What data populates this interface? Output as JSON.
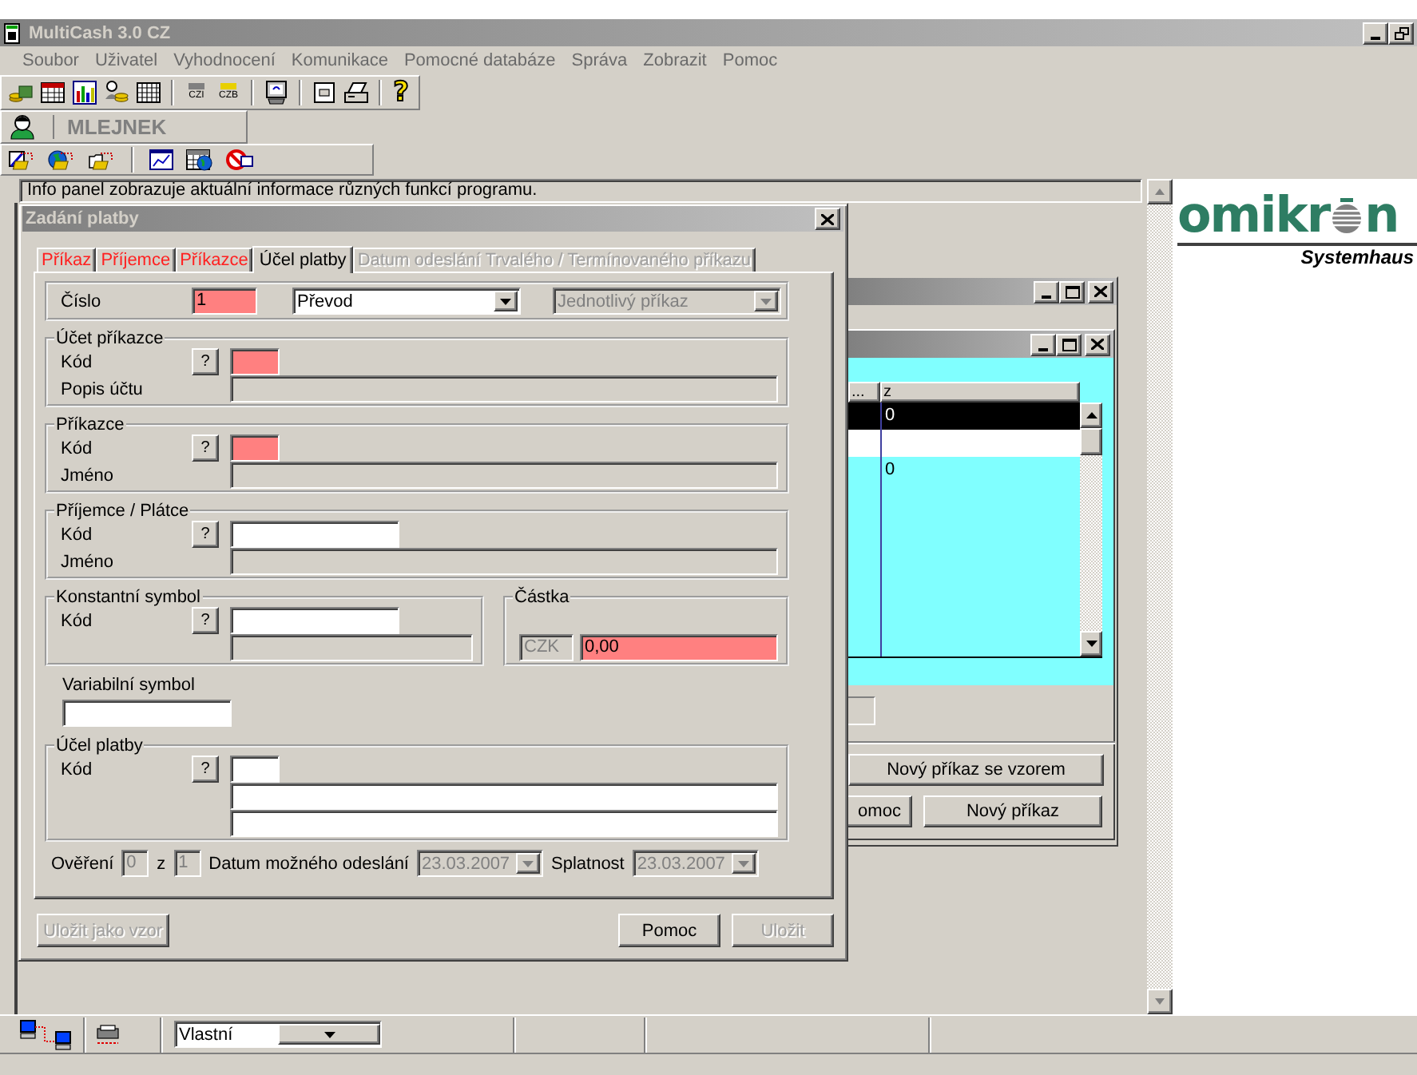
{
  "window": {
    "title": "MultiCash 3.0 CZ"
  },
  "menu": [
    "Soubor",
    "Uživatel",
    "Vyhodnocení",
    "Komunikace",
    "Pomocné databáze",
    "Správa",
    "Zobrazit",
    "Pomoc"
  ],
  "toolbar": {
    "card_labels": [
      "CZI",
      "CZB"
    ],
    "help": "?"
  },
  "user": {
    "name": "MLEJNEK"
  },
  "info_panel": "Info panel zobrazuje aktuální informace různých funkcí programu.",
  "logo": {
    "text_before": "omikr",
    "text_after": "n",
    "tagline": "Systemhaus"
  },
  "order_window": {
    "table": {
      "columns": [
        "...",
        "z"
      ],
      "rows": [
        {
          "value": "0",
          "selected": true,
          "highlighted": false
        },
        {
          "selected": false,
          "highlighted": true
        },
        {
          "value": "0",
          "selected": false,
          "highlighted": false
        }
      ]
    },
    "buttons": [
      "Nový příkaz se vzorem",
      "omoc",
      "Nový příkaz"
    ]
  },
  "dialog": {
    "title": "Zadání platby",
    "tabs": [
      {
        "label": "Příkaz",
        "selected": false,
        "invalid": true,
        "disabled": false
      },
      {
        "label": "Příjemce",
        "selected": false,
        "invalid": true,
        "disabled": false
      },
      {
        "label": "Příkazce",
        "selected": false,
        "invalid": true,
        "disabled": false
      },
      {
        "label": "Účel platby",
        "selected": true,
        "invalid": false,
        "disabled": false
      },
      {
        "label": "Datum odeslání Trvalého / Termínovaného příkazu",
        "selected": false,
        "invalid": false,
        "disabled": true
      }
    ],
    "number": {
      "label": "Číslo",
      "value": "1",
      "required": true
    },
    "payment_type": {
      "value": "Převod",
      "disabled": false
    },
    "order_type": {
      "value": "Jednotlivý příkaz",
      "disabled": true
    },
    "groups": [
      {
        "title": "Účet příkazce",
        "rows": [
          {
            "label": "Kód",
            "help": "?",
            "field": {
              "kind": "code",
              "required": true,
              "disabled": false
            }
          },
          {
            "label": "Popis účtu",
            "field": {
              "kind": "description",
              "required": false,
              "disabled": true
            }
          }
        ]
      },
      {
        "title": "Příkazce",
        "rows": [
          {
            "label": "Kód",
            "help": "?",
            "field": {
              "kind": "code",
              "required": true,
              "disabled": false
            }
          },
          {
            "label": "Jméno",
            "field": {
              "kind": "description",
              "required": false,
              "disabled": true
            }
          }
        ]
      },
      {
        "title": "Příjemce / Plátce",
        "rows": [
          {
            "label": "Kód",
            "help": "?",
            "field": {
              "kind": "text",
              "required": false,
              "disabled": false
            }
          },
          {
            "label": "Jméno",
            "field": {
              "kind": "description",
              "required": false,
              "disabled": true
            }
          }
        ]
      }
    ],
    "constant_symbol": {
      "title": "Konstantní symbol",
      "rows": [
        {
          "label": "Kód",
          "help": "?",
          "field": {
            "kind": "text",
            "required": false,
            "disabled": false
          }
        },
        {
          "field": {
            "kind": "symbol",
            "required": false,
            "disabled": true
          }
        }
      ]
    },
    "amount": {
      "title": "Částka",
      "currency": "CZK",
      "value": "0,00",
      "required": true
    },
    "variable_symbol": {
      "label": "Variabilní symbol"
    },
    "purpose": {
      "title": "Účel platby",
      "rows": [
        {
          "label": "Kód",
          "help": "?",
          "field": {
            "kind": "code",
            "required": false,
            "disabled": false
          }
        },
        {
          "field": {
            "kind": "description",
            "required": false,
            "disabled": false
          }
        },
        {
          "field": {
            "kind": "description",
            "required": false,
            "disabled": false
          }
        }
      ]
    },
    "verification": {
      "label": "Ověření",
      "current": "0",
      "separator": "z",
      "total": "1"
    },
    "send_date": {
      "label": "Datum možného odeslání",
      "value": "23.03.2007",
      "disabled": true
    },
    "due_date": {
      "label": "Splatnost",
      "value": "23.03.2007",
      "disabled": true
    },
    "buttons": [
      {
        "label": "Uložit jako vzor",
        "disabled": true
      },
      {
        "label": "Pomoc",
        "disabled": false
      },
      {
        "label": "Uložit",
        "disabled": true
      }
    ]
  },
  "status_bar": {
    "view": "Vlastní"
  }
}
